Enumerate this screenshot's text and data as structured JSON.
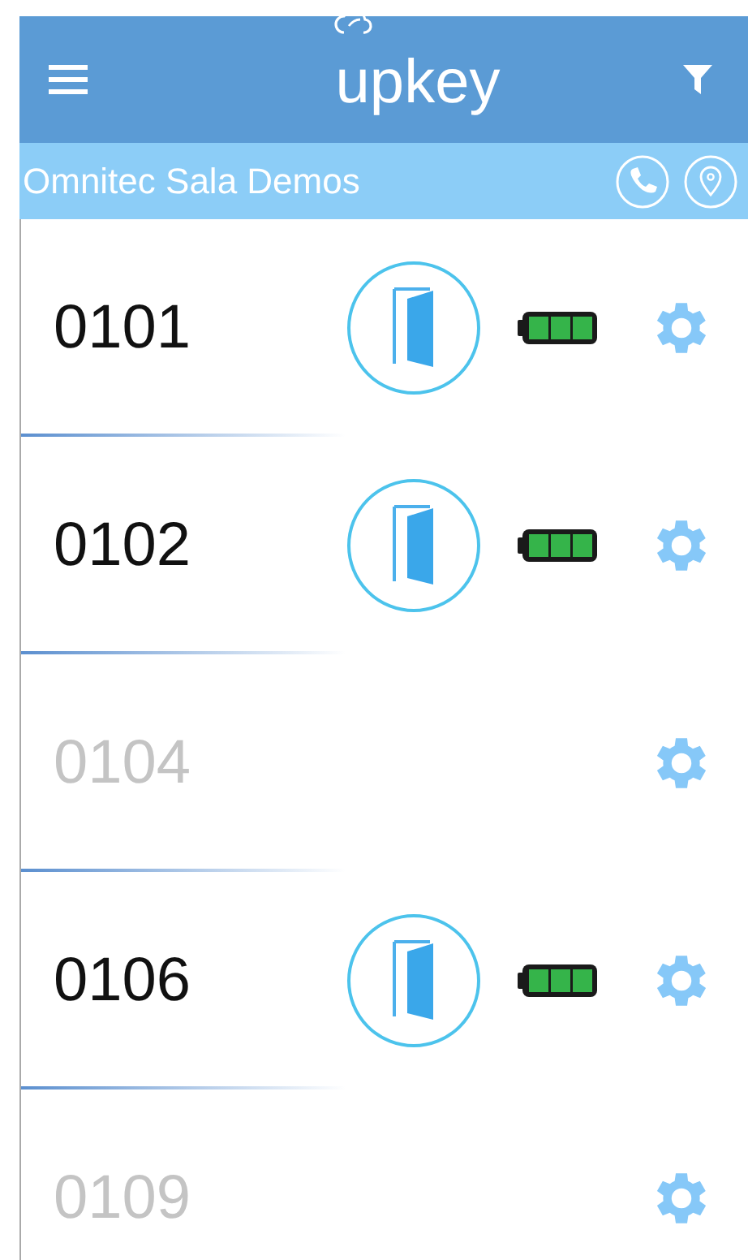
{
  "header": {
    "logo": "upkey"
  },
  "site": {
    "name": "Omnitec Sala Demos"
  },
  "locks": [
    {
      "number": "0101",
      "disabled": false
    },
    {
      "number": "0102",
      "disabled": false
    },
    {
      "number": "0104",
      "disabled": true
    },
    {
      "number": "0106",
      "disabled": false
    },
    {
      "number": "0109",
      "disabled": true
    }
  ]
}
